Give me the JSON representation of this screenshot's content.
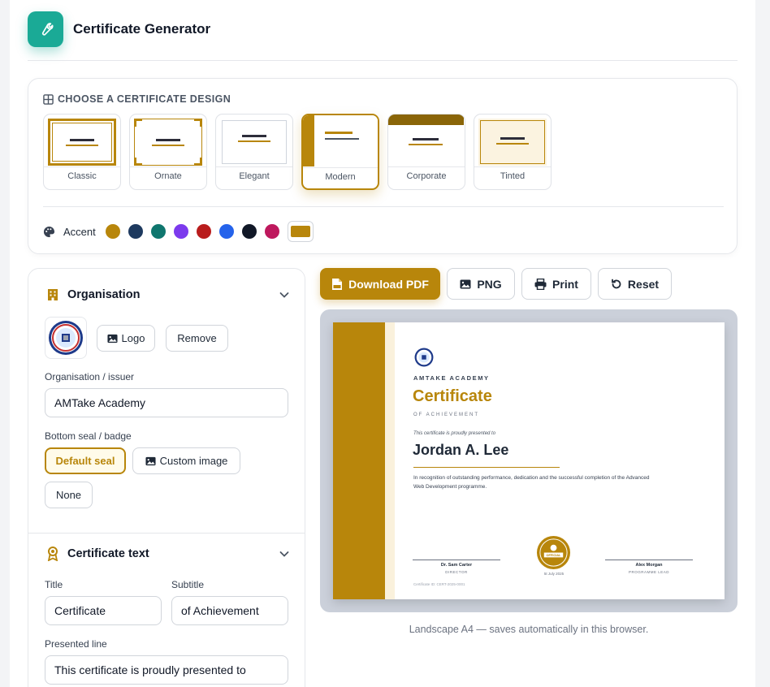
{
  "app": {
    "title": "Certificate Generator",
    "icon": "wrench-icon"
  },
  "designs": {
    "heading": "CHOOSE A CERTIFICATE DESIGN",
    "selected": "Modern",
    "items": [
      {
        "label": "Classic"
      },
      {
        "label": "Ornate"
      },
      {
        "label": "Elegant"
      },
      {
        "label": "Modern"
      },
      {
        "label": "Corporate"
      },
      {
        "label": "Tinted"
      }
    ]
  },
  "accent": {
    "label": "Accent",
    "colors": [
      "#b8860b",
      "#1e3a5f",
      "#0f766e",
      "#7c3aed",
      "#b91c1c",
      "#2563eb",
      "#111827",
      "#be185d"
    ],
    "selected": "#b8860b"
  },
  "organisation": {
    "section_title": "Organisation",
    "logo_button": "Logo",
    "remove_button": "Remove",
    "issuer_label": "Organisation / issuer",
    "issuer_value": "AMTake Academy",
    "seal_label": "Bottom seal / badge",
    "seal_options": [
      "Default seal",
      "Custom image",
      "None"
    ],
    "seal_selected": "Default seal"
  },
  "certificate_text": {
    "section_title": "Certificate text",
    "title_label": "Title",
    "title_value": "Certificate",
    "subtitle_label": "Subtitle",
    "subtitle_value": "of Achievement",
    "presented_label": "Presented line",
    "presented_value": "This certificate is proudly presented to"
  },
  "toolbar": {
    "download_pdf": "Download PDF",
    "png": "PNG",
    "print": "Print",
    "reset": "Reset"
  },
  "preview": {
    "org": "AMTAKE ACADEMY",
    "title": "Certificate",
    "subtitle": "OF ACHIEVEMENT",
    "presented": "This certificate is proudly presented to",
    "name": "Jordan A. Lee",
    "body": "In recognition of outstanding performance, dedication and the successful completion of the Advanced Web Development programme.",
    "sig_left_name": "Dr. Sam Carter",
    "sig_left_role": "DIRECTOR",
    "sig_right_name": "Alex Morgan",
    "sig_right_role": "PROGRAMME LEAD",
    "date": "5t July 2025",
    "certificate_id": "Certificate ID: CERT-2025-0001",
    "seal_text": "OFFICIAL",
    "caption": "Landscape A4 — saves automatically in this browser."
  }
}
